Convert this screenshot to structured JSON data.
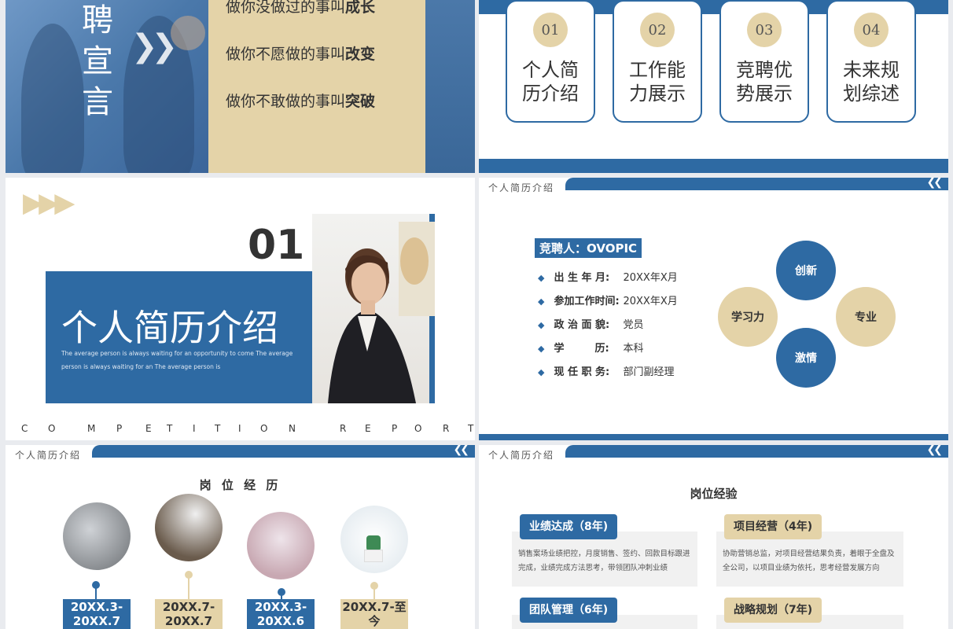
{
  "slide1": {
    "vertical_title": [
      "聘",
      "宣",
      "言"
    ],
    "lines": [
      {
        "prefix": "做你没做过的事叫",
        "bold": "成长"
      },
      {
        "prefix": "做你不愿做的事叫",
        "bold": "改变"
      },
      {
        "prefix": "做你不敢做的事叫",
        "bold": "突破"
      }
    ]
  },
  "slide2": {
    "cards": [
      {
        "num": "01",
        "text": "个人简历介绍"
      },
      {
        "num": "02",
        "text": "工作能力展示"
      },
      {
        "num": "03",
        "text": "竞聘优势展示"
      },
      {
        "num": "04",
        "text": "未来规划综述"
      }
    ]
  },
  "slide3": {
    "number": "01",
    "title": "个人简历介绍",
    "subtitle": "The average person is always waiting for an opportunity to come The average person is always waiting for an The average person is",
    "footer_letters": [
      "C",
      "O",
      "M",
      "P",
      "E",
      "T",
      "I",
      "T",
      "I",
      "O",
      "N",
      "",
      "R",
      "E",
      "P",
      "O",
      "R",
      "T"
    ]
  },
  "slide4": {
    "header": "个人简历介绍",
    "tag": "竞聘人：OVOPIC",
    "rows": [
      {
        "k": "出 生 年 月:",
        "v": "20XX年X月"
      },
      {
        "k": "参加工作时间:",
        "v": "20XX年X月"
      },
      {
        "k": "政 治 面 貌:",
        "v": "党员"
      },
      {
        "k": "学　　　历:",
        "v": "本科"
      },
      {
        "k": "现 任 职 务:",
        "v": "部门副经理"
      }
    ],
    "circles": {
      "top": "创新",
      "left": "学习力",
      "right": "专业",
      "bottom": "激情"
    },
    "colors": {
      "blue": "#2e6aa3",
      "tan": "#e4d3a8"
    }
  },
  "slide5": {
    "header": "个人简历介绍",
    "title": "岗 位 经 历",
    "items": [
      {
        "period": "20XX.3-20XX.7"
      },
      {
        "period": "20XX.7-20XX.7"
      },
      {
        "period": "20XX.3-20XX.6"
      },
      {
        "period": "20XX.7-至今"
      }
    ]
  },
  "slide6": {
    "header": "个人简历介绍",
    "title": "岗位经验",
    "blocks": [
      {
        "label": "业绩达成（8年)",
        "desc": "销售案场业绩把控，月度销售、签约、回款目标跟进完成，业绩完成方法思考，带领团队冲刺业绩"
      },
      {
        "label": "项目经营（4年)",
        "desc": "协助营销总监，对项目经营结果负责，着眼于全盘及全公司，以项目业绩为依托，思考经营发展方向"
      },
      {
        "label": "团队管理（6年)",
        "desc": ""
      },
      {
        "label": "战略规划（7年)",
        "desc": ""
      }
    ]
  }
}
